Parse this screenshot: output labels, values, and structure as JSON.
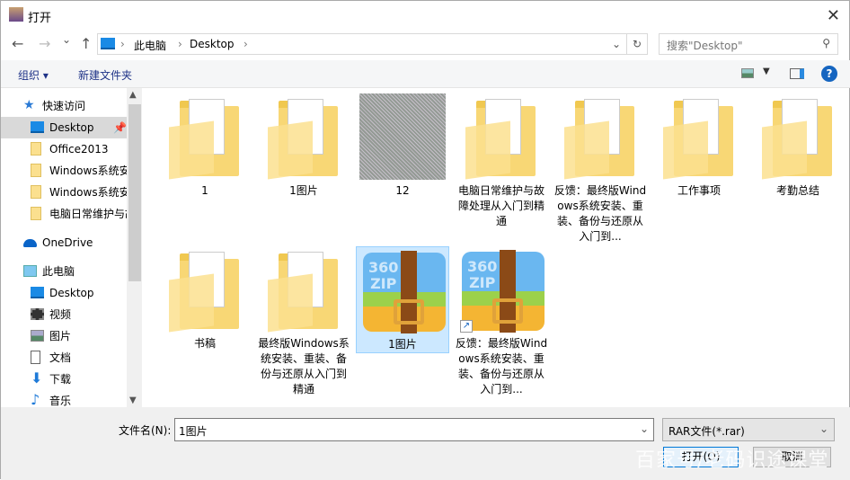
{
  "window": {
    "title": "打开",
    "close": "✕"
  },
  "nav": {
    "back": "←",
    "forward": "→",
    "recent": "⌄",
    "up": "↑",
    "path": [
      "此电脑",
      "Desktop"
    ],
    "refresh": "↻"
  },
  "search": {
    "placeholder": "搜索\"Desktop\""
  },
  "toolbar": {
    "organize": "组织 ▾",
    "new_folder": "新建文件夹"
  },
  "sidebar": {
    "items": [
      {
        "label": "快速访问",
        "icon": "star-icon"
      },
      {
        "label": "Desktop",
        "icon": "desktop-icon",
        "selected": true
      },
      {
        "label": "Office2013",
        "icon": "folder-icon"
      },
      {
        "label": "Windows系统安",
        "icon": "folder-icon"
      },
      {
        "label": "Windows系统安",
        "icon": "folder-icon"
      },
      {
        "label": "电脑日常维护与故",
        "icon": "folder-icon"
      },
      {
        "label": "OneDrive",
        "icon": "cloud-icon"
      },
      {
        "label": "此电脑",
        "icon": "computer-icon"
      },
      {
        "label": "Desktop",
        "icon": "desktop-icon"
      },
      {
        "label": "视频",
        "icon": "video-icon"
      },
      {
        "label": "图片",
        "icon": "picture-icon"
      },
      {
        "label": "文档",
        "icon": "document-icon"
      },
      {
        "label": "下载",
        "icon": "download-icon"
      },
      {
        "label": "音乐",
        "icon": "music-icon"
      }
    ]
  },
  "files": [
    {
      "name": "1",
      "type": "folder"
    },
    {
      "name": "1图片",
      "type": "folder"
    },
    {
      "name": "12",
      "type": "image"
    },
    {
      "name": "电脑日常维护与故障处理从入门到精通",
      "type": "folder"
    },
    {
      "name": "反馈：最终版Windows系统安装、重装、备份与还原从入门到...",
      "type": "folder"
    },
    {
      "name": "工作事项",
      "type": "folder"
    },
    {
      "name": "考勤总结",
      "type": "folder"
    },
    {
      "name": "书稿",
      "type": "folder"
    },
    {
      "name": "最终版Windows系统安装、重装、备份与还原从入门到精通",
      "type": "folder"
    },
    {
      "name": "1图片",
      "type": "rar",
      "selected": true
    },
    {
      "name": "反馈：最终版Windows系统安装、重装、备份与还原从入门到...",
      "type": "rar-shortcut"
    }
  ],
  "bottom": {
    "filename_label": "文件名(N):",
    "filename_value": "1图片",
    "filetype": "RAR文件(*.rar)",
    "open": "打开(O)",
    "cancel": "取消"
  },
  "watermark": "百家号/老码识途课堂"
}
